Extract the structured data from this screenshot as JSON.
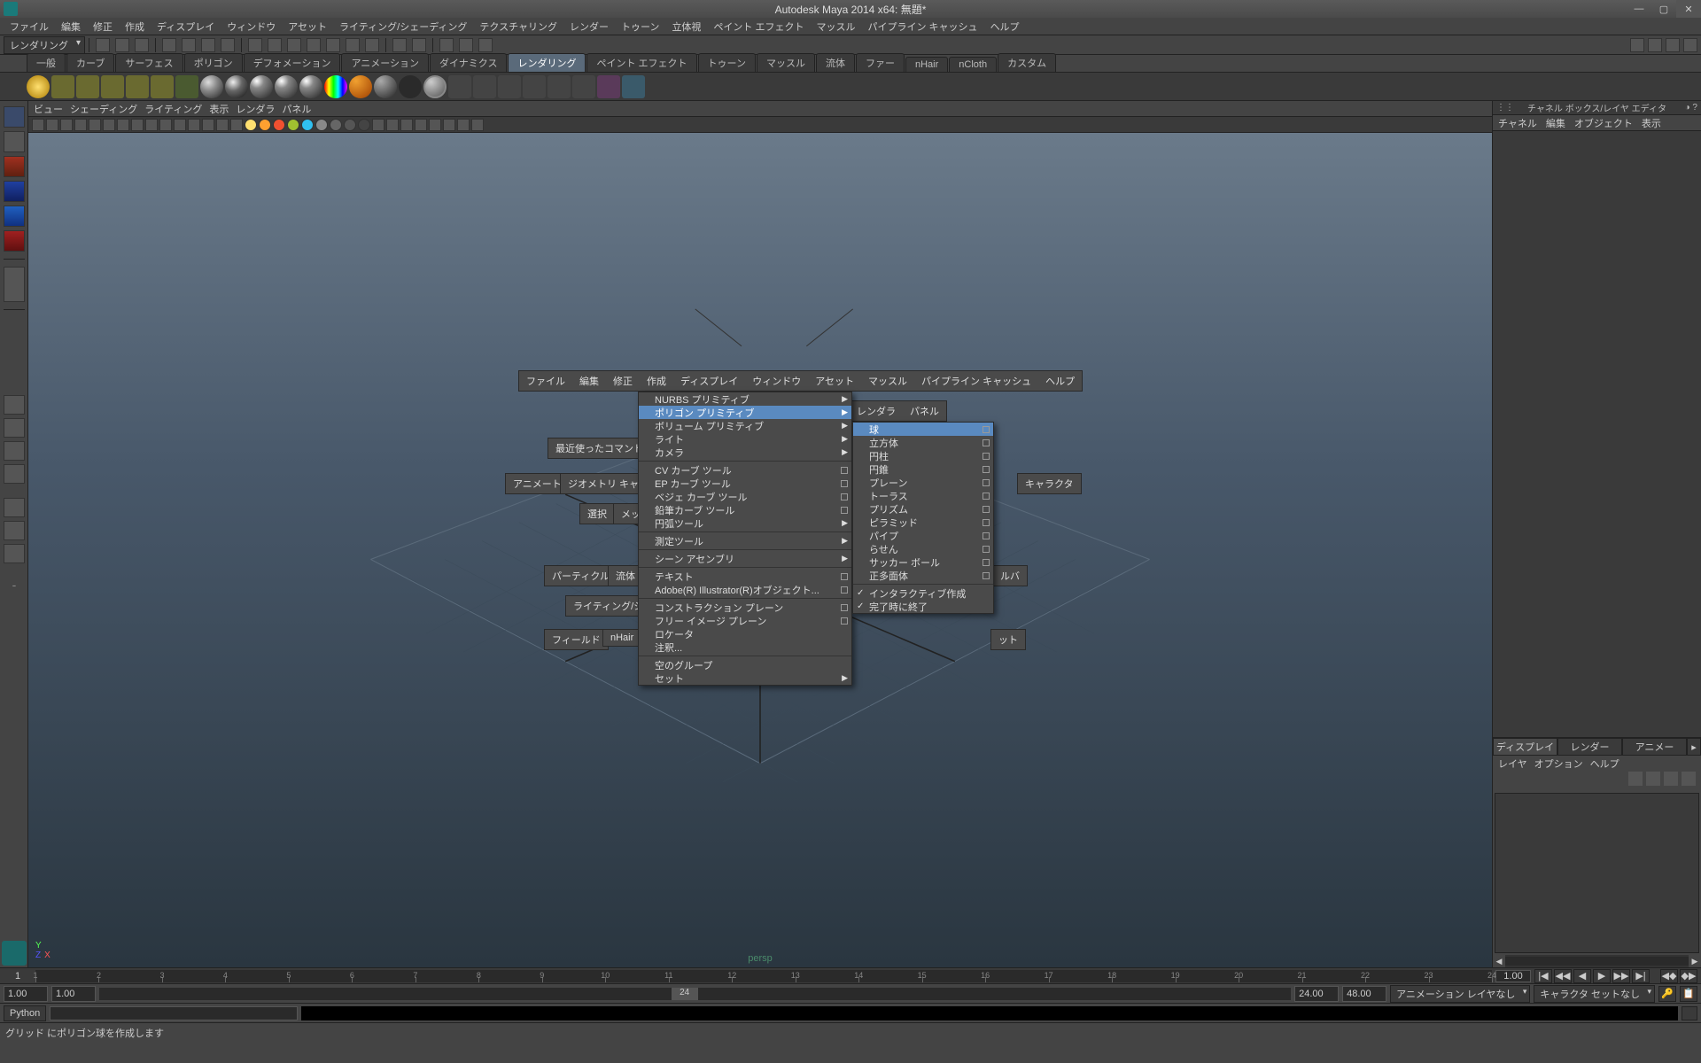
{
  "title": "Autodesk Maya 2014 x64:  無題*",
  "menu": [
    "ファイル",
    "編集",
    "修正",
    "作成",
    "ディスプレイ",
    "ウィンドウ",
    "アセット",
    "ライティング/シェーディング",
    "テクスチャリング",
    "レンダー",
    "トゥーン",
    "立体視",
    "ペイント エフェクト",
    "マッスル",
    "パイプライン キャッシュ",
    "ヘルプ"
  ],
  "module_selector": "レンダリング",
  "shelf_tabs": [
    "一般",
    "カーブ",
    "サーフェス",
    "ポリゴン",
    "デフォメーション",
    "アニメーション",
    "ダイナミクス",
    "レンダリング",
    "ペイント エフェクト",
    "トゥーン",
    "マッスル",
    "流体",
    "ファー",
    "nHair",
    "nCloth",
    "カスタム"
  ],
  "shelf_active_index": 7,
  "viewport_menu": [
    "ビュー",
    "シェーディング",
    "ライティング",
    "表示",
    "レンダラ",
    "パネル"
  ],
  "right_panel": {
    "title": "チャネル ボックス/レイヤ エディタ",
    "menus": [
      "チャネル",
      "編集",
      "オブジェクト",
      "表示"
    ],
    "layer_tabs": [
      "ディスプレイ",
      "レンダー",
      "アニメー"
    ],
    "layer_menu": [
      "レイヤ",
      "オプション",
      "ヘルプ"
    ]
  },
  "hotbox_top_row": [
    "ファイル",
    "編集",
    "修正",
    "作成",
    "ディスプレイ",
    "ウィンドウ",
    "アセット",
    "マッスル",
    "パイプライン キャッシュ",
    "ヘルプ"
  ],
  "hotbox_items": {
    "recent": "最近使ったコマンド",
    "animate": "アニメート",
    "geocache": "ジオメトリ キャッシ",
    "charset": "キャラクタ",
    "select": "選択",
    "mesh": "メッシ",
    "particle": "パーティクル",
    "fluid": "流体",
    "lighting": "ライティング/シェ",
    "cloth": "ルバ",
    "fields": "フィールド",
    "nhair": "nHair",
    "what": "ット"
  },
  "create_menu": [
    {
      "label": "NURBS プリミティブ",
      "arrow": true
    },
    {
      "label": "ポリゴン プリミティブ",
      "arrow": true,
      "hl": true
    },
    {
      "label": "ボリューム プリミティブ",
      "arrow": true
    },
    {
      "label": "ライト",
      "arrow": true
    },
    {
      "label": "カメラ",
      "arrow": true
    },
    {
      "sep": true
    },
    {
      "label": "CV カーブ ツール",
      "box": true
    },
    {
      "label": "EP カーブ ツール",
      "box": true
    },
    {
      "label": "ベジェ カーブ ツール",
      "box": true
    },
    {
      "label": "鉛筆カーブ ツール",
      "box": true
    },
    {
      "label": "円弧ツール",
      "arrow": true
    },
    {
      "sep": true
    },
    {
      "label": "測定ツール",
      "arrow": true
    },
    {
      "sep": true
    },
    {
      "label": "シーン アセンブリ",
      "arrow": true
    },
    {
      "sep": true
    },
    {
      "label": "テキスト",
      "box": true
    },
    {
      "label": "Adobe(R) Illustrator(R)オブジェクト...",
      "box": true
    },
    {
      "sep": true
    },
    {
      "label": "コンストラクション プレーン",
      "box": true
    },
    {
      "label": "フリー イメージ プレーン",
      "box": true
    },
    {
      "label": "ロケータ"
    },
    {
      "label": "注釈..."
    },
    {
      "sep": true
    },
    {
      "label": "空のグループ"
    },
    {
      "label": "セット",
      "arrow": true
    }
  ],
  "poly_submenu": [
    {
      "label": "球",
      "box": true,
      "hl": true
    },
    {
      "label": "立方体",
      "box": true
    },
    {
      "label": "円柱",
      "box": true
    },
    {
      "label": "円錐",
      "box": true
    },
    {
      "label": "プレーン",
      "box": true
    },
    {
      "label": "トーラス",
      "box": true
    },
    {
      "label": "プリズム",
      "box": true
    },
    {
      "label": "ピラミッド",
      "box": true
    },
    {
      "label": "パイプ",
      "box": true
    },
    {
      "label": "らせん",
      "box": true
    },
    {
      "label": "サッカー ボール",
      "box": true
    },
    {
      "label": "正多面体",
      "box": true
    },
    {
      "sep": true
    },
    {
      "label": "インタラクティブ作成",
      "check": true
    },
    {
      "label": "完了時に終了",
      "check": true
    }
  ],
  "time": {
    "current": "1",
    "start_full": "1.00",
    "start": "1.00",
    "end": "24.00",
    "end_full": "48.00",
    "handle": "24",
    "ticks": [
      "1",
      "2",
      "3",
      "4",
      "5",
      "6",
      "7",
      "8",
      "9",
      "10",
      "11",
      "12",
      "13",
      "14",
      "15",
      "16",
      "17",
      "18",
      "19",
      "20",
      "21",
      "22",
      "23",
      "24"
    ]
  },
  "range_combo1": "アニメーション レイヤなし",
  "range_combo2": "キャラクタ セットなし",
  "cmd_lang": "Python",
  "status_msg": "グリッド にポリゴン球を作成します",
  "persp": "persp"
}
